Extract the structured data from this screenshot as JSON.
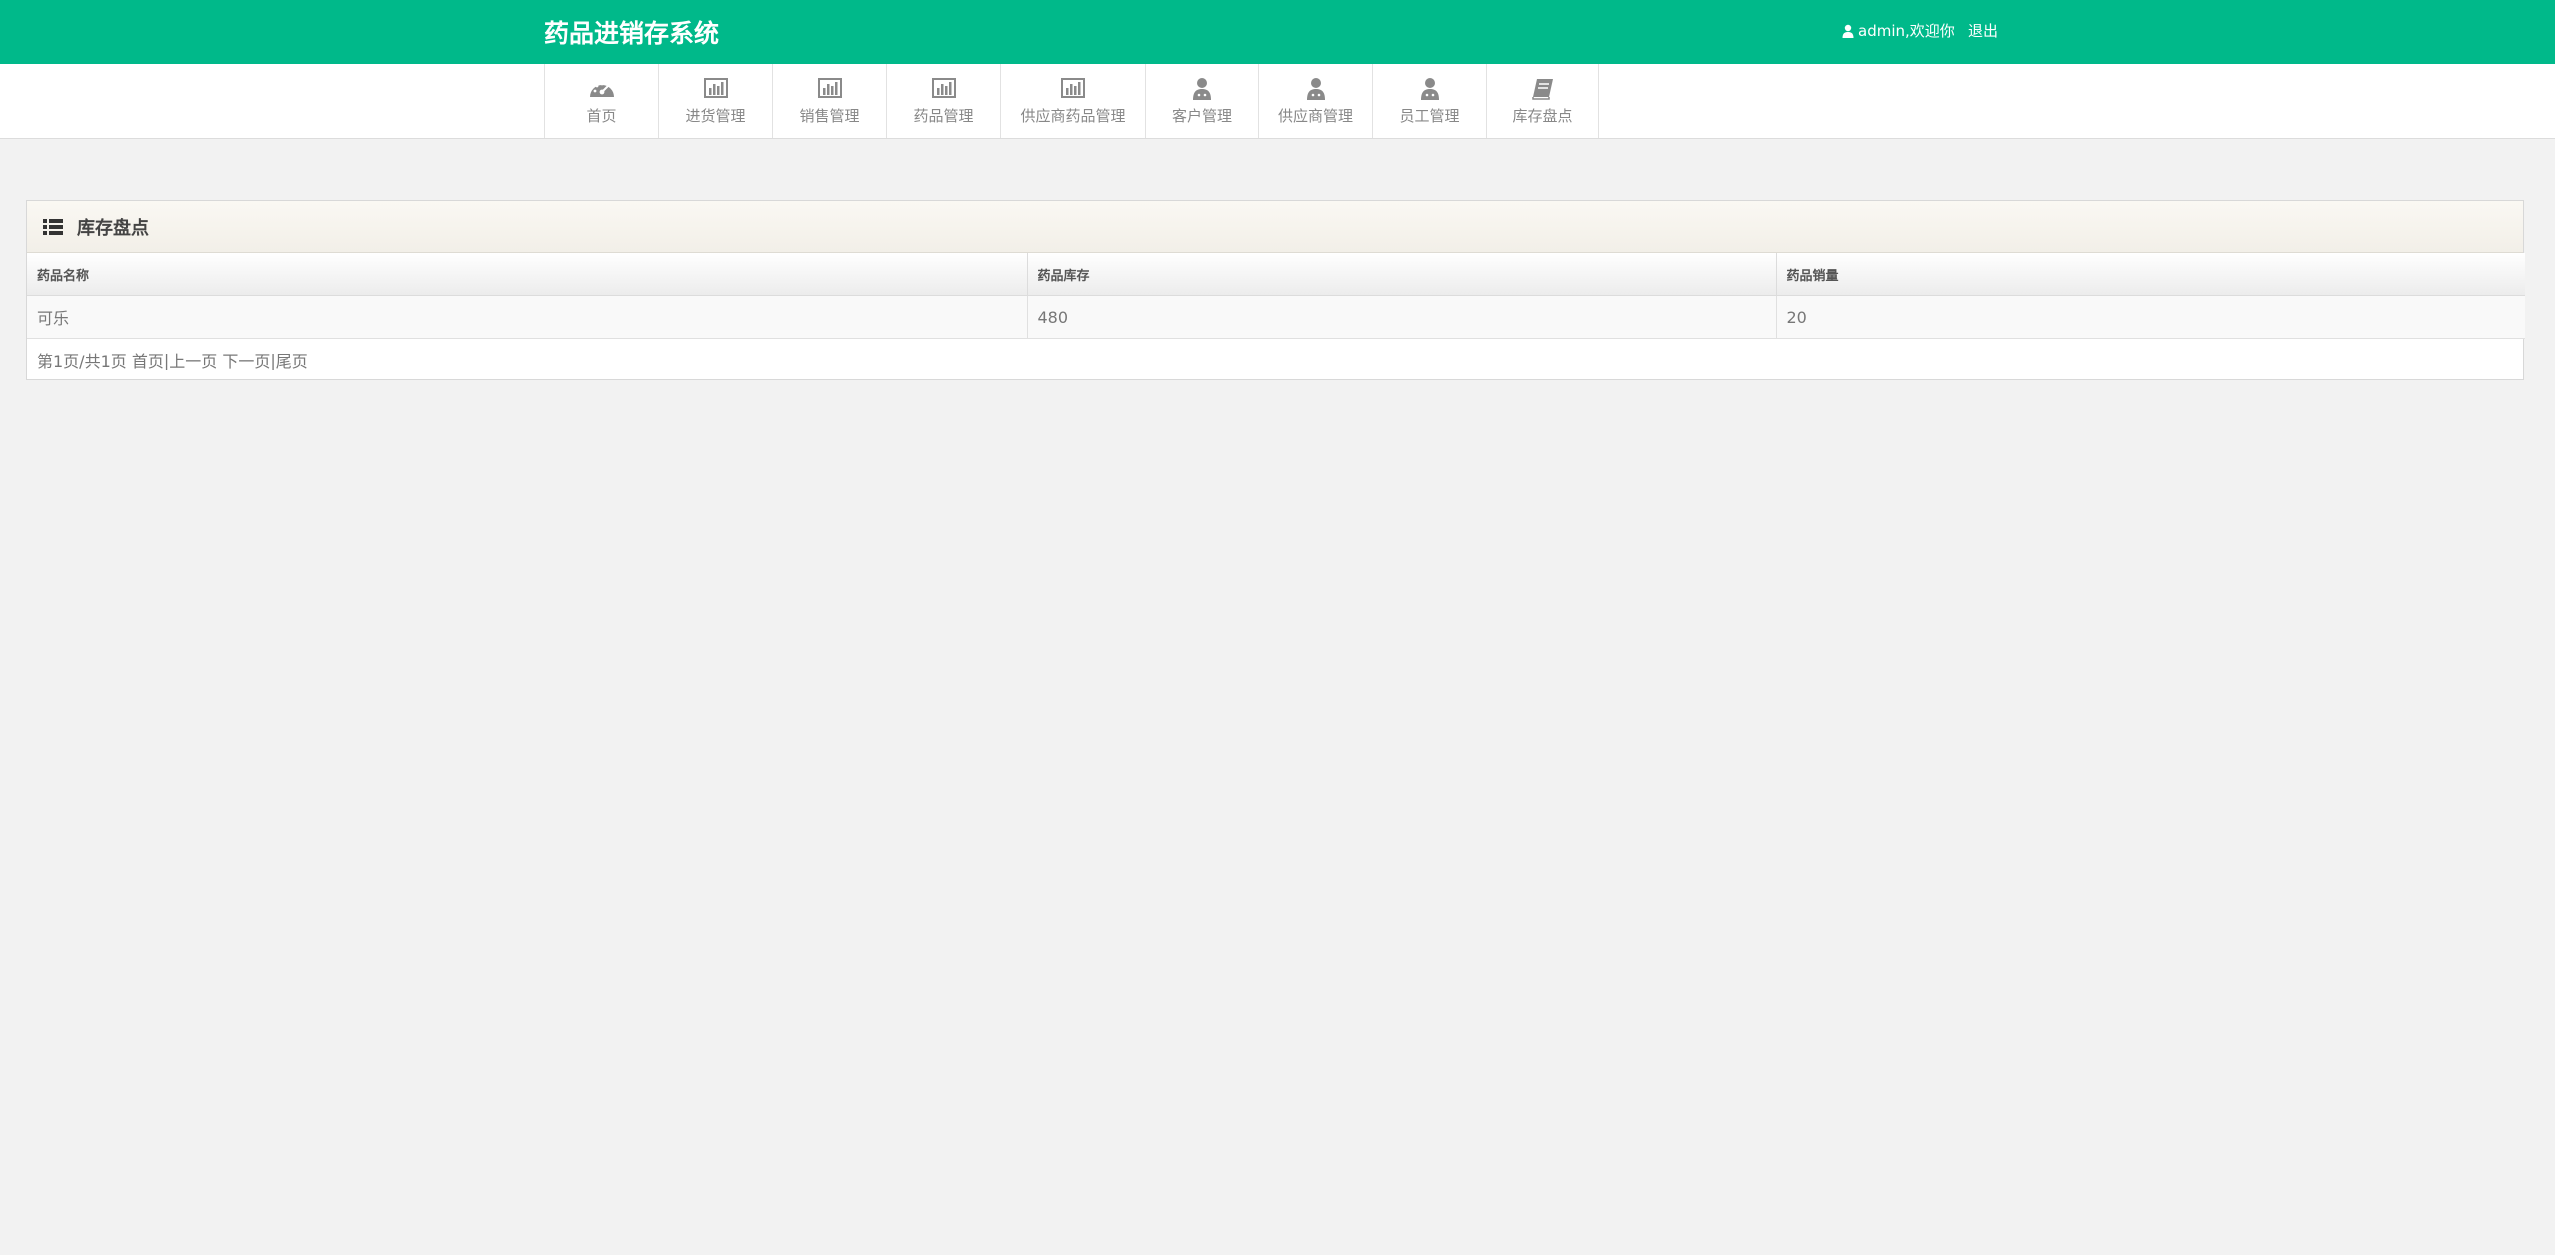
{
  "header": {
    "brand": "药品进销存系统",
    "user_text": "admin,欢迎你",
    "logout": "退出",
    "colors": {
      "bar": "#00b98a"
    }
  },
  "nav": {
    "items": [
      {
        "label": "首页",
        "icon": "dashboard-icon"
      },
      {
        "label": "进货管理",
        "icon": "bar-chart-icon"
      },
      {
        "label": "销售管理",
        "icon": "bar-chart-icon"
      },
      {
        "label": "药品管理",
        "icon": "bar-chart-icon"
      },
      {
        "label": "供应商药品管理",
        "icon": "bar-chart-icon"
      },
      {
        "label": "客户管理",
        "icon": "user-icon"
      },
      {
        "label": "供应商管理",
        "icon": "user-icon"
      },
      {
        "label": "员工管理",
        "icon": "user-icon"
      },
      {
        "label": "库存盘点",
        "icon": "book-icon"
      }
    ]
  },
  "panel": {
    "title": "库存盘点",
    "icon": "list-icon",
    "columns": [
      "药品名称",
      "药品库存",
      "药品销量"
    ],
    "rows": [
      [
        "可乐",
        "480",
        "20"
      ]
    ],
    "pager": {
      "info": "第1页/共1页",
      "first": "首页",
      "prev": "上一页",
      "next": "下一页",
      "last": "尾页",
      "sep": "|"
    }
  }
}
